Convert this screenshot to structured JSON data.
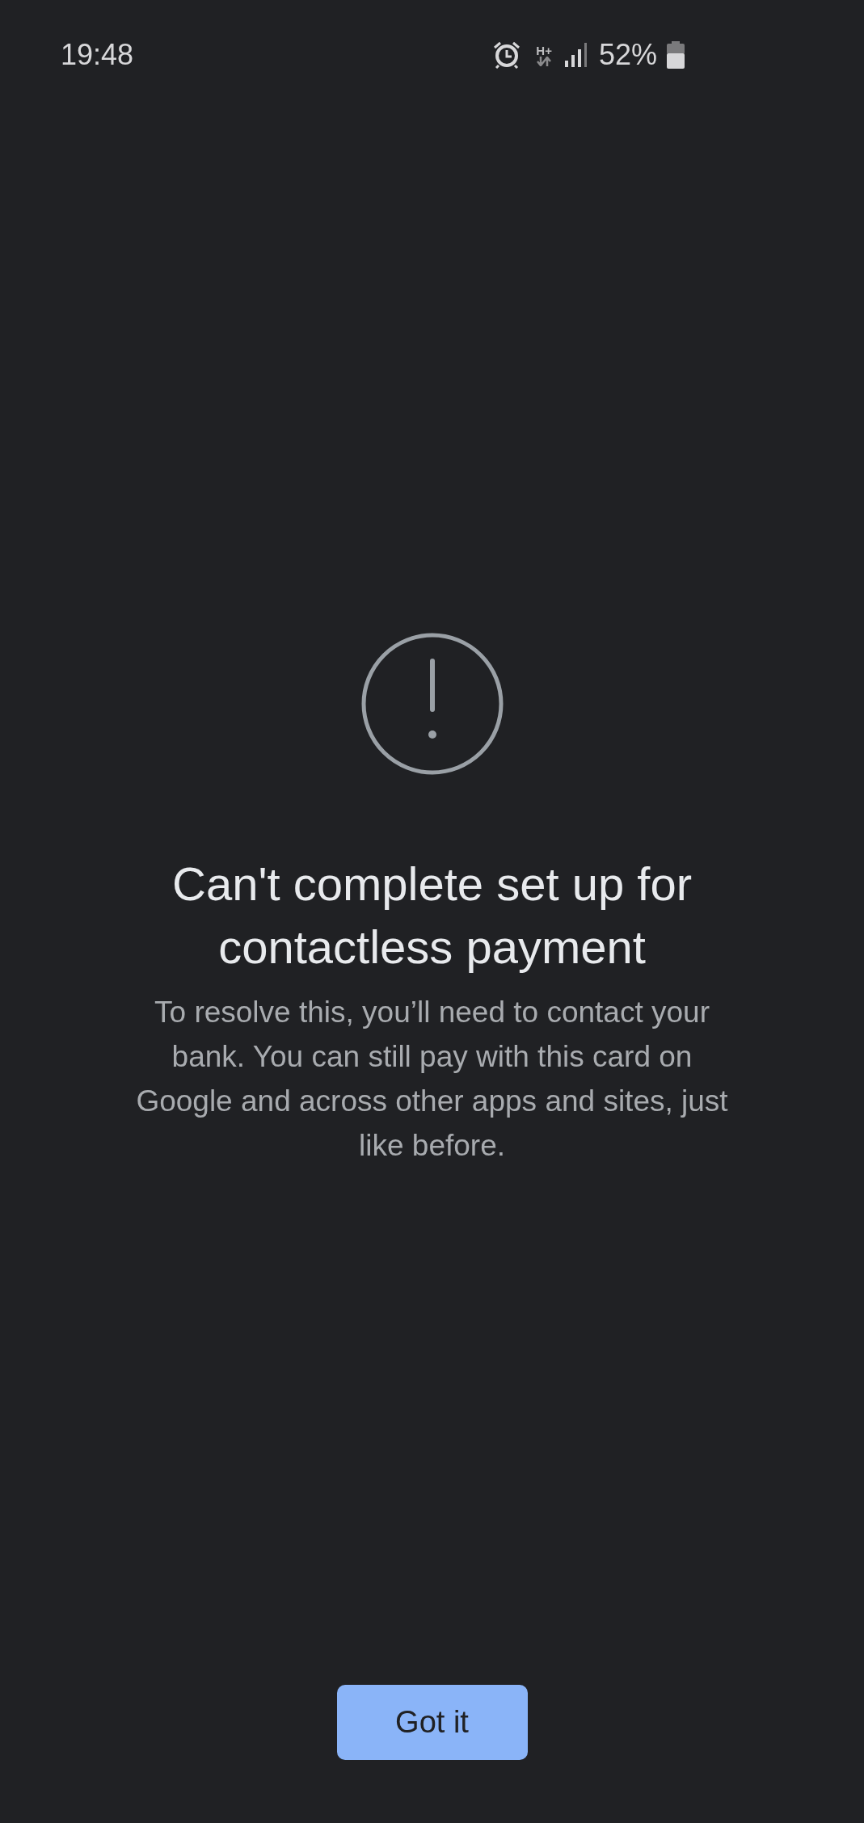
{
  "status_bar": {
    "time": "19:48",
    "network_type": "H+",
    "battery": "52%"
  },
  "error": {
    "title": "Can't complete set up for contactless payment",
    "message": "To resolve this, you’ll need to contact your bank. You can still pay with this card on Google and across other apps and sites, just like before."
  },
  "buttons": [
    {
      "label": "Got it",
      "kind": "primary"
    }
  ]
}
